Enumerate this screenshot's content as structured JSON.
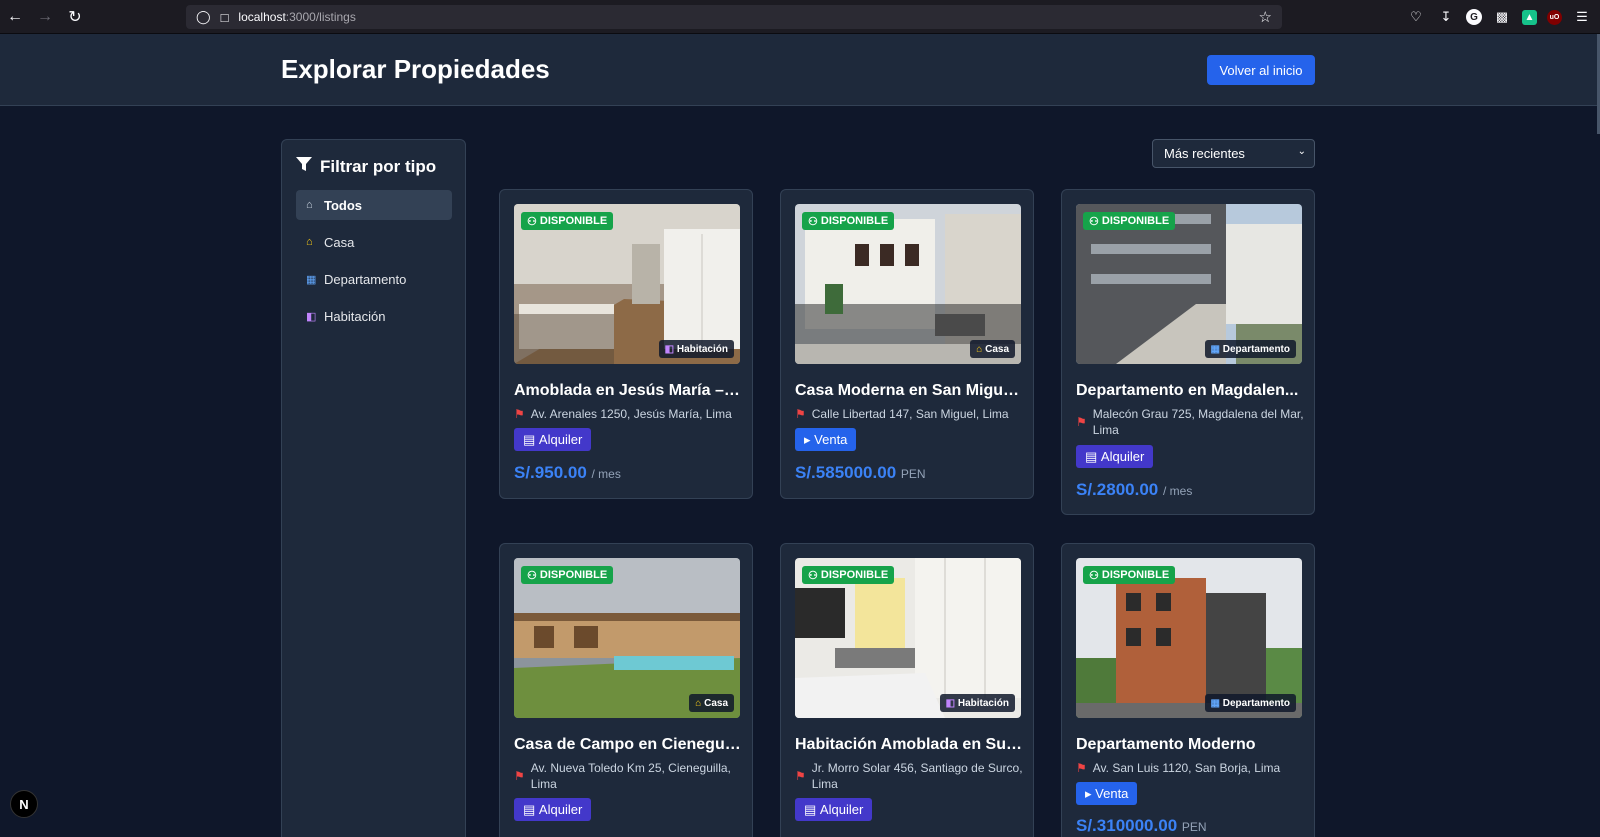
{
  "browser": {
    "url_host": "localhost",
    "url_path": ":3000/listings"
  },
  "header": {
    "title": "Explorar Propiedades",
    "home_button": "Volver al inicio"
  },
  "sidebar": {
    "title": "Filtrar por tipo",
    "items": [
      {
        "label": "Todos",
        "icon": "home-icon",
        "active": true
      },
      {
        "label": "Casa",
        "icon": "house-icon",
        "active": false
      },
      {
        "label": "Departamento",
        "icon": "building-icon",
        "active": false
      },
      {
        "label": "Habitación",
        "icon": "door-icon",
        "active": false
      }
    ]
  },
  "sort": {
    "selected": "Más recientes"
  },
  "listings": [
    {
      "status": "DISPONIBLE",
      "type": "Habitación",
      "title": "Amoblada en Jesús María – I...",
      "address": "Av. Arenales 1250, Jesús María, Lima",
      "deal": "Alquiler",
      "price": "S/.950.00",
      "unit": "/ mes"
    },
    {
      "status": "DISPONIBLE",
      "type": "Casa",
      "title": "Casa Moderna en San Migue...",
      "address": "Calle Libertad 147, San Miguel, Lima",
      "deal": "Venta",
      "price": "S/.585000.00",
      "unit": "PEN"
    },
    {
      "status": "DISPONIBLE",
      "type": "Departamento",
      "title": "Departamento en Magdalen...",
      "address": "Malecón Grau 725, Magdalena del Mar, Lima",
      "deal": "Alquiler",
      "price": "S/.2800.00",
      "unit": "/ mes"
    },
    {
      "status": "DISPONIBLE",
      "type": "Casa",
      "title": "Casa de Campo en Cienegui...",
      "address": "Av. Nueva Toledo Km 25, Cieneguilla, Lima",
      "deal": "Alquiler",
      "price": "",
      "unit": ""
    },
    {
      "status": "DISPONIBLE",
      "type": "Habitación",
      "title": "Habitación Amoblada en Sur...",
      "address": "Jr. Morro Solar 456, Santiago de Surco, Lima",
      "deal": "Alquiler",
      "price": "",
      "unit": ""
    },
    {
      "status": "DISPONIBLE",
      "type": "Departamento",
      "title": "Departamento Moderno",
      "address": "Av. San Luis 1120, San Borja, Lima",
      "deal": "Venta",
      "price": "S/.310000.00",
      "unit": "PEN"
    }
  ],
  "dev_badge": "N"
}
